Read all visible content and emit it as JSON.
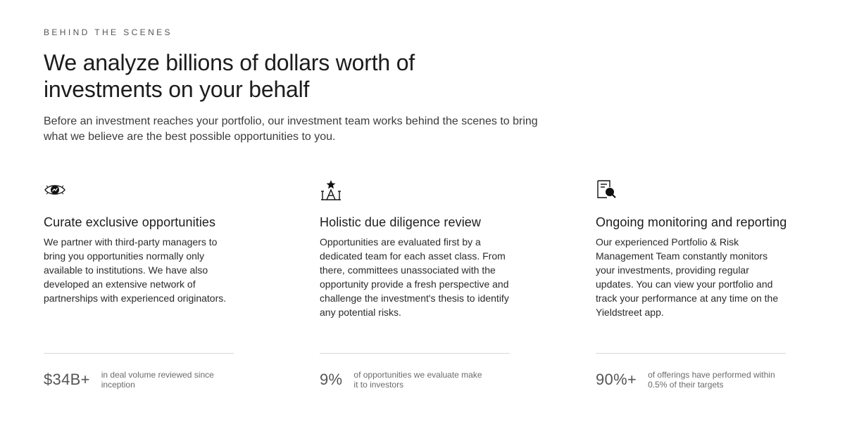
{
  "section": {
    "eyebrow": "BEHIND THE SCENES",
    "headline": "We analyze billions of dollars worth of investments on your behalf",
    "lede": "Before an investment reaches your portfolio, our investment team works behind the scenes to bring what we believe are the best possible opportunities to you."
  },
  "cards": [
    {
      "icon": "eye-chart-icon",
      "title": "Curate exclusive opportunities",
      "body": "We partner with third-party managers to bring you opportunities normally only available to institutions. We have also developed an extensive network of partnerships with experienced originators.",
      "stat_value": "$34B+",
      "stat_label": "in deal volume reviewed since inception"
    },
    {
      "icon": "star-arch-icon",
      "title": "Holistic due diligence review",
      "body": "Opportunities are evaluated first by a dedicated team for each asset class. From there, committees unassociated with the opportunity provide a fresh perspective and challenge the investment's thesis to identify any potential risks.",
      "stat_value": "9%",
      "stat_label": "of opportunities we evaluate make it to investors"
    },
    {
      "icon": "document-magnifier-icon",
      "title": "Ongoing monitoring and reporting",
      "body": "Our experienced Portfolio & Risk Management Team constantly monitors your investments, providing regular updates. You can view your portfolio and track your performance at any time on the Yieldstreet app.",
      "stat_value": "90%+",
      "stat_label": "of offerings have performed within 0.5% of their targets"
    }
  ],
  "colors": {
    "text_primary": "#1c1c1c",
    "text_secondary": "#555555",
    "divider": "#d9d9d9",
    "background": "#ffffff"
  }
}
